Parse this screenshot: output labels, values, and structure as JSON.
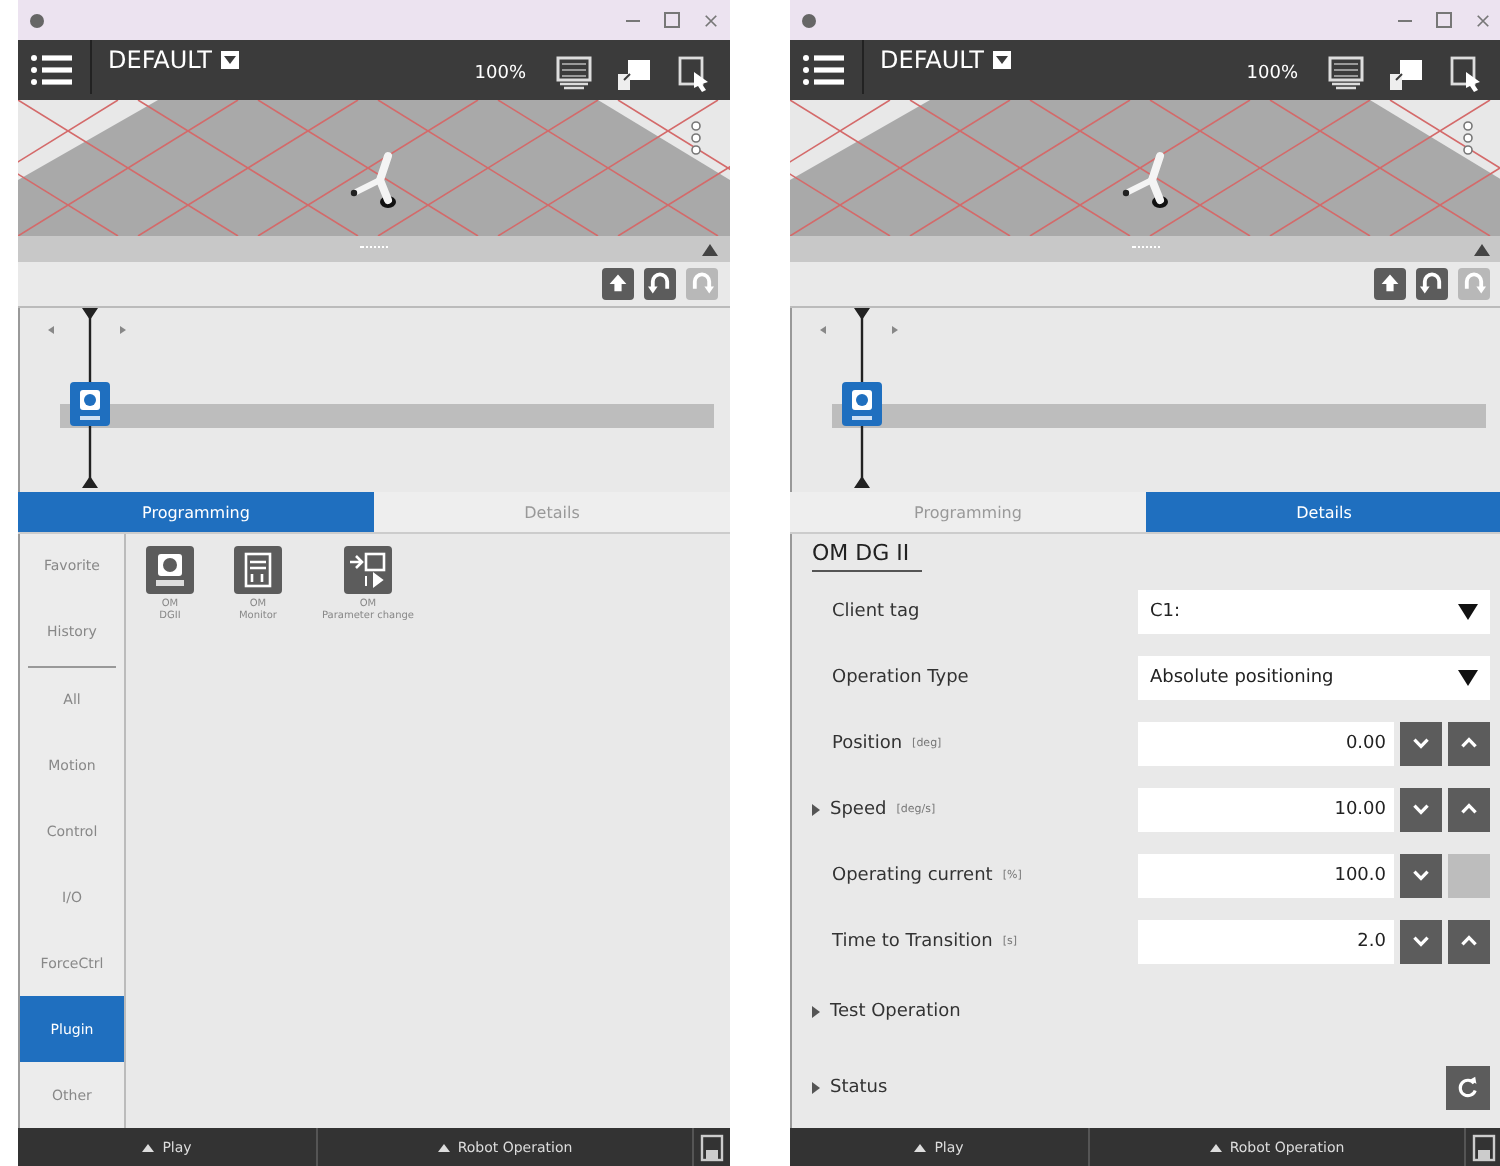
{
  "windows": [
    {
      "header": {
        "title": "DEFAULT",
        "zoom": "100%"
      },
      "toolbar": [
        {
          "kind": "upload",
          "disabled": false
        },
        {
          "kind": "undo",
          "disabled": false
        },
        {
          "kind": "redo",
          "disabled": true
        }
      ],
      "tabs": [
        {
          "label": "Programming",
          "selected": true
        },
        {
          "label": "Details",
          "selected": false
        }
      ],
      "panel": {
        "kind": "programming",
        "pinned_categories": [
          {
            "label": "Favorite",
            "selected": false
          },
          {
            "label": "History",
            "selected": false
          }
        ],
        "categories": [
          {
            "label": "All",
            "selected": false
          },
          {
            "label": "Motion",
            "selected": false
          },
          {
            "label": "Control",
            "selected": false
          },
          {
            "label": "I/O",
            "selected": false
          },
          {
            "label": "ForceCtrl",
            "selected": false
          },
          {
            "label": "Plugin",
            "selected": true
          },
          {
            "label": "Other",
            "selected": false
          }
        ],
        "commands": [
          {
            "kind": "gripper",
            "line1": "OM",
            "line2": "DGII"
          },
          {
            "kind": "monitor",
            "line1": "OM",
            "line2": "Monitor"
          },
          {
            "kind": "parameter",
            "line1": "OM",
            "line2": "Parameter change"
          }
        ]
      },
      "footer": {
        "play": "Play",
        "robot_operation": "Robot Operation"
      }
    },
    {
      "header": {
        "title": "DEFAULT",
        "zoom": "100%"
      },
      "toolbar": [
        {
          "kind": "upload",
          "disabled": false
        },
        {
          "kind": "undo",
          "disabled": false
        },
        {
          "kind": "redo",
          "disabled": true
        }
      ],
      "tabs": [
        {
          "label": "Programming",
          "selected": false
        },
        {
          "label": "Details",
          "selected": true
        }
      ],
      "panel": {
        "kind": "details",
        "title": "OM DG II",
        "fields": [
          {
            "kind": "dropdown",
            "label": "Client tag",
            "value": "C1:"
          },
          {
            "kind": "dropdown",
            "label": "Operation Type",
            "value": "Absolute positioning"
          },
          {
            "kind": "number",
            "label": "Position",
            "unit": "[deg]",
            "value": "0.00",
            "up_disabled": false
          },
          {
            "kind": "group",
            "label": "Speed",
            "unit": "[deg/s]",
            "value": "10.00",
            "up_disabled": false,
            "expanded": false
          },
          {
            "kind": "number",
            "label": "Operating current",
            "unit": "[%]",
            "value": "100.0",
            "up_disabled": true
          },
          {
            "kind": "number",
            "label": "Time to Transition",
            "unit": "[s]",
            "value": "2.0",
            "up_disabled": false
          }
        ],
        "sections": [
          {
            "kind": "plain",
            "label": "Test Operation",
            "expanded": false
          },
          {
            "kind": "refresh",
            "label": "Status",
            "expanded": false
          }
        ]
      },
      "footer": {
        "play": "Play",
        "robot_operation": "Robot Operation"
      }
    }
  ]
}
